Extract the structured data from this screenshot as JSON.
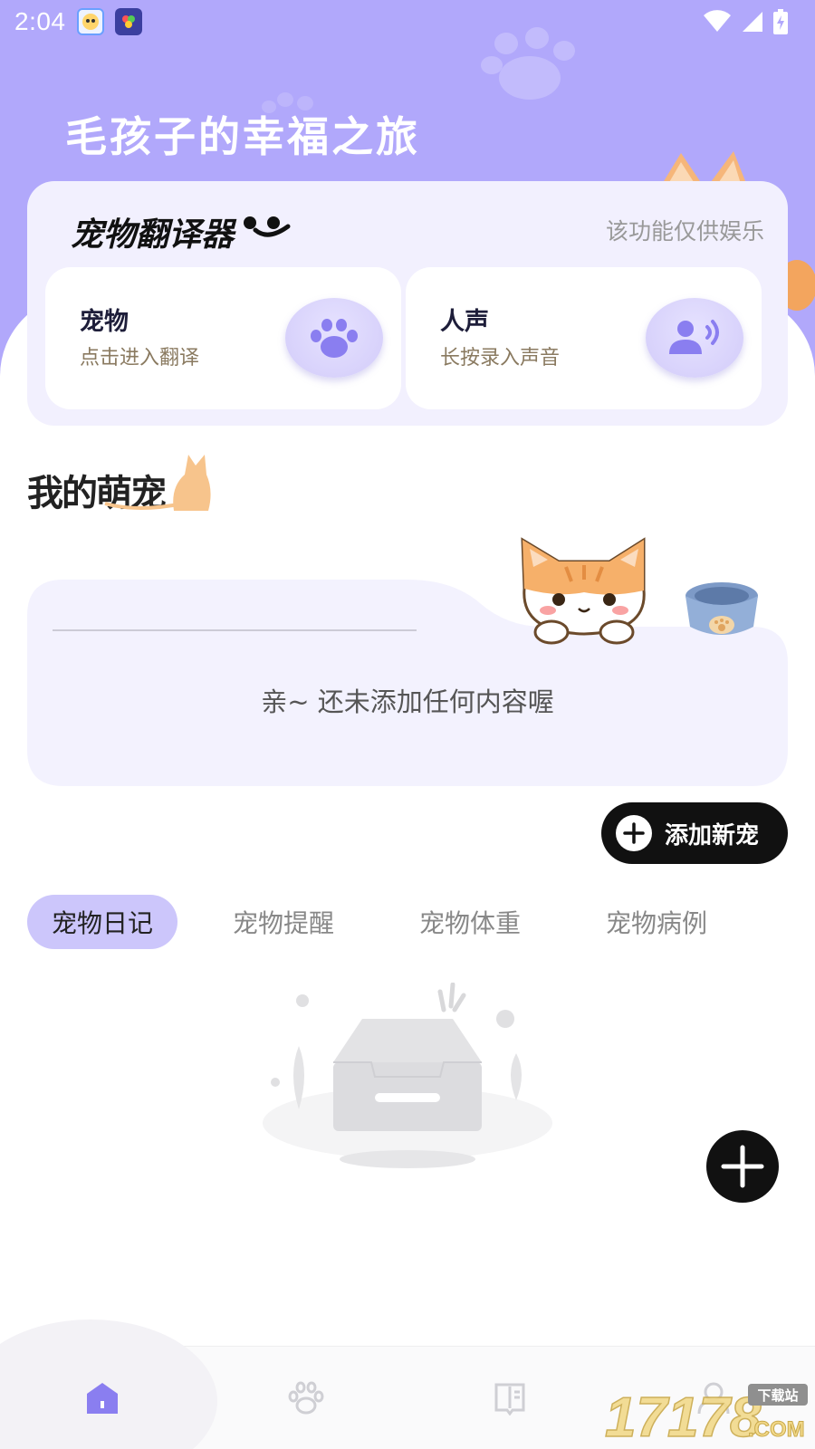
{
  "status_bar": {
    "time": "2:04"
  },
  "hero": {
    "title": "毛孩子的幸福之旅"
  },
  "translator": {
    "title": "宠物翻译器",
    "note": "该功能仅供娱乐",
    "options": [
      {
        "title": "宠物",
        "subtitle": "点击进入翻译",
        "icon": "paw-icon"
      },
      {
        "title": "人声",
        "subtitle": "长按录入声音",
        "icon": "voice-icon"
      }
    ]
  },
  "my_pets": {
    "title": "我的萌宠",
    "empty_text": "亲~ 还未添加任何内容喔",
    "add_button_label": "添加新宠"
  },
  "tabs": [
    {
      "label": "宠物日记",
      "active": true
    },
    {
      "label": "宠物提醒",
      "active": false
    },
    {
      "label": "宠物体重",
      "active": false
    },
    {
      "label": "宠物病例",
      "active": false
    }
  ],
  "bottom_nav": [
    {
      "icon": "home-icon",
      "active": true
    },
    {
      "icon": "paw-icon",
      "active": false
    },
    {
      "icon": "book-icon",
      "active": false
    },
    {
      "icon": "profile-icon",
      "active": false
    }
  ],
  "watermark": {
    "text": "17178",
    "badge": "下载站",
    "suffix": ".COM"
  },
  "colors": {
    "accent": "#b1a8fb",
    "active_tab": "#ccc6fb",
    "dark": "#111111",
    "home_icon": "#8a7ef0"
  }
}
